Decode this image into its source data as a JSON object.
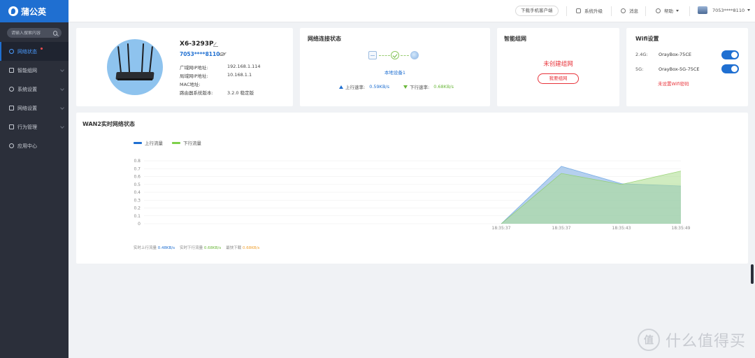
{
  "app": {
    "logo_text": "蒲公英"
  },
  "sidebar": {
    "search_placeholder": "请输入搜索内容",
    "items": [
      {
        "label": "网络状态",
        "icon": "status-icon",
        "active": true,
        "badge": true
      },
      {
        "label": "智能组网",
        "icon": "mesh-icon"
      },
      {
        "label": "系统设置",
        "icon": "gear-icon"
      },
      {
        "label": "网络设置",
        "icon": "network-icon"
      },
      {
        "label": "行为管理",
        "icon": "behavior-icon"
      },
      {
        "label": "应用中心",
        "icon": "apps-icon"
      }
    ]
  },
  "topbar": {
    "download_client": "下载手机客户端",
    "upgrade": "系统升级",
    "messages": "消息",
    "help": "帮助",
    "user": "7053****8110"
  },
  "device": {
    "name": "X6-3293P",
    "id": "7053****8110",
    "rows": [
      {
        "label": "广域网IP地址:",
        "value": "192.168.1.114"
      },
      {
        "label": "局域网IP地址:",
        "value": "10.168.1.1"
      },
      {
        "label": "MAC地址:",
        "value": ""
      },
      {
        "label": "路由器系统版本:",
        "value": "3.2.0 稳定版"
      }
    ]
  },
  "network_status": {
    "title": "网络连接状态",
    "local_device": "本地设备1",
    "up_label": "上行速率:",
    "up_value": "0.59KB/s",
    "down_label": "下行速率:",
    "down_value": "0.68KB/s"
  },
  "mesh": {
    "title": "智能组网",
    "status": "未创建组网",
    "button": "我要组网"
  },
  "wifi": {
    "title": "Wifi设置",
    "bands": [
      {
        "band": "2.4G:",
        "ssid": "OrayBox-75CE",
        "enabled": true
      },
      {
        "band": "5G:",
        "ssid": "OrayBox-5G-75CE",
        "enabled": true
      }
    ],
    "warning": "未设置Wifi密码"
  },
  "wan_chart": {
    "title": "WAN2实时网络状态",
    "stats": {
      "up_label": "实时上行流量",
      "up_value": "0.48KB/s",
      "down_label": "实时下行流量",
      "down_value": "0.68KB/s",
      "max_label": "最快下载",
      "max_value": "0.68KB/s"
    }
  },
  "chart_data": {
    "type": "area",
    "title": "WAN2实时网络状态",
    "categories": [
      "18:35:37",
      "18:35:37",
      "18:35:43",
      "18:35:49"
    ],
    "y_ticks": [
      "0.8",
      "0.7",
      "0.6",
      "0.5",
      "0.4",
      "0.3",
      "0.2",
      "0.1",
      "0"
    ],
    "ylim": [
      0,
      0.8
    ],
    "series": [
      {
        "name": "上行流量",
        "color": "#5b9bd5",
        "values": [
          0,
          0.73,
          0.51,
          0.48
        ]
      },
      {
        "name": "下行流量",
        "color": "#9bd86b",
        "values": [
          0,
          0.64,
          0.5,
          0.67
        ]
      }
    ],
    "legend": "top-left",
    "grid": true
  },
  "watermark": {
    "circle_text": "值",
    "text": "什么值得买"
  }
}
